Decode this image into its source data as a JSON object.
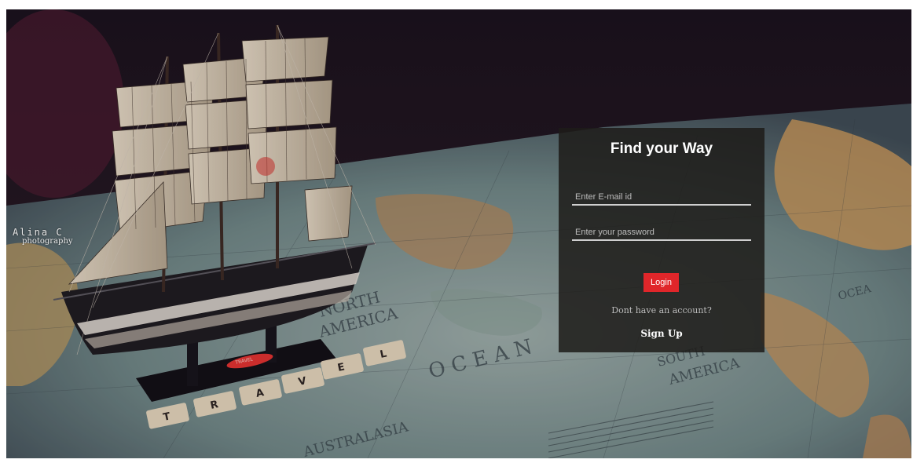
{
  "watermark": {
    "name": "Alina C",
    "subtitle": "photography"
  },
  "background": {
    "map_labels": {
      "north": "NORTH",
      "america": "AMERICA",
      "ocean": "O C E A N",
      "south": "SOUTH",
      "south_america": "AMERICA",
      "australasia": "AUSTRALASIA",
      "ocean_right": "OCEA"
    },
    "tiles": [
      "T",
      "R",
      "A",
      "V",
      "E",
      "L"
    ],
    "ship_plaque": "TRAVEL"
  },
  "login": {
    "title": "Find your Way",
    "email_placeholder": "Enter E-mail id",
    "password_placeholder": "Enter your password",
    "login_label": "Login",
    "signup_prompt": "Dont have an account?",
    "signup_label": "Sign Up"
  },
  "colors": {
    "accent": "#e0262a",
    "card_background": "#1e1c1a"
  }
}
